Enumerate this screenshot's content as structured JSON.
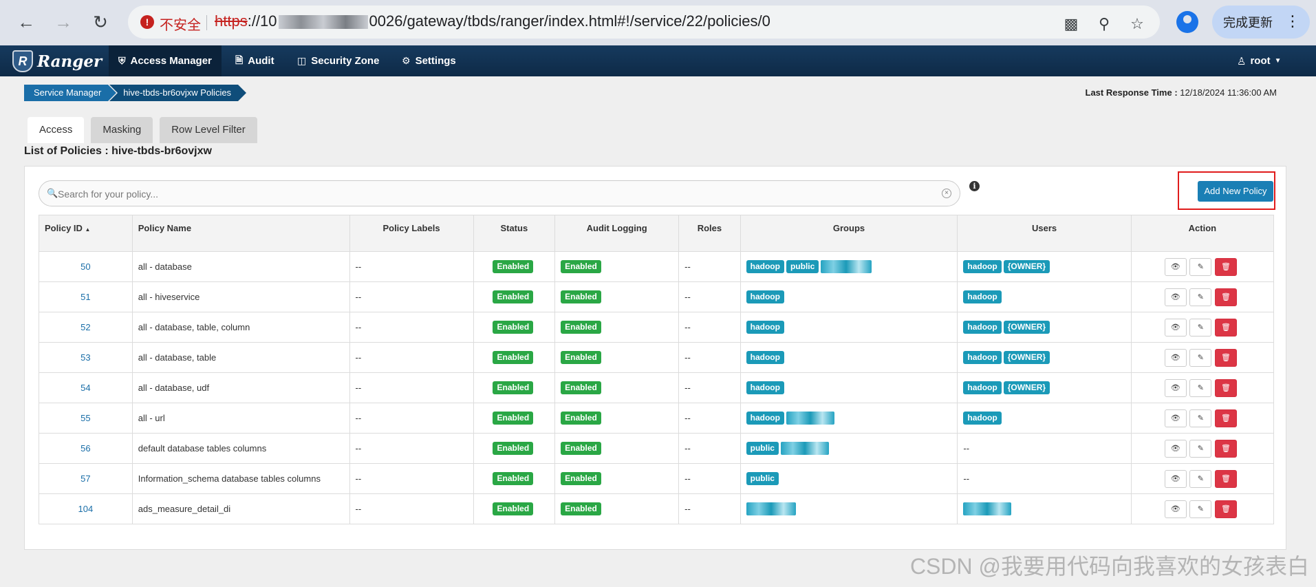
{
  "browser": {
    "security_label": "不安全",
    "url_scheme": "https",
    "url_host_prefix": "://10",
    "url_rest": "0026/gateway/tbds/ranger/index.html#!/service/22/policies/0",
    "update_label": "完成更新"
  },
  "nav": {
    "brand": "Ranger",
    "items": [
      {
        "label": "Access Manager"
      },
      {
        "label": "Audit"
      },
      {
        "label": "Security Zone"
      },
      {
        "label": "Settings"
      }
    ],
    "user": "root"
  },
  "breadcrumb": [
    "Service Manager",
    "hive-tbds-br6ovjxw Policies"
  ],
  "last_response": {
    "label": "Last Response Time :",
    "value": "12/18/2024 11:36:00 AM"
  },
  "tabs": [
    {
      "label": "Access",
      "active": true
    },
    {
      "label": "Masking",
      "active": false
    },
    {
      "label": "Row Level Filter",
      "active": false
    }
  ],
  "list_title": "List of Policies : hive-tbds-br6ovjxw",
  "search": {
    "placeholder": "Search for your policy..."
  },
  "add_button": "Add New Policy",
  "columns": [
    "Policy ID",
    "Policy Name",
    "Policy Labels",
    "Status",
    "Audit Logging",
    "Roles",
    "Groups",
    "Users",
    "Action"
  ],
  "rows": [
    {
      "id": "50",
      "name": "all - database",
      "labels": "--",
      "status": "Enabled",
      "audit": "Enabled",
      "roles": "--",
      "groups": [
        "hadoop",
        "public"
      ],
      "users": [
        "hadoop",
        "{OWNER}"
      ]
    },
    {
      "id": "51",
      "name": "all - hiveservice",
      "labels": "--",
      "status": "Enabled",
      "audit": "Enabled",
      "roles": "--",
      "groups": [
        "hadoop"
      ],
      "users": [
        "hadoop"
      ]
    },
    {
      "id": "52",
      "name": "all - database, table, column",
      "labels": "--",
      "status": "Enabled",
      "audit": "Enabled",
      "roles": "--",
      "groups": [
        "hadoop"
      ],
      "users": [
        "hadoop",
        "{OWNER}"
      ]
    },
    {
      "id": "53",
      "name": "all - database, table",
      "labels": "--",
      "status": "Enabled",
      "audit": "Enabled",
      "roles": "--",
      "groups": [
        "hadoop"
      ],
      "users": [
        "hadoop",
        "{OWNER}"
      ]
    },
    {
      "id": "54",
      "name": "all - database, udf",
      "labels": "--",
      "status": "Enabled",
      "audit": "Enabled",
      "roles": "--",
      "groups": [
        "hadoop"
      ],
      "users": [
        "hadoop",
        "{OWNER}"
      ]
    },
    {
      "id": "55",
      "name": "all - url",
      "labels": "--",
      "status": "Enabled",
      "audit": "Enabled",
      "roles": "--",
      "groups": [
        "hadoop"
      ],
      "users": [
        "hadoop"
      ]
    },
    {
      "id": "56",
      "name": "default database tables columns",
      "labels": "--",
      "status": "Enabled",
      "audit": "Enabled",
      "roles": "--",
      "groups": [
        "public"
      ],
      "users_text": "--"
    },
    {
      "id": "57",
      "name": "Information_schema database tables columns",
      "labels": "--",
      "status": "Enabled",
      "audit": "Enabled",
      "roles": "--",
      "groups": [
        "public"
      ],
      "users_text": "--"
    },
    {
      "id": "104",
      "name": "ads_measure_detail_di",
      "labels": "--",
      "status": "Enabled",
      "audit": "Enabled",
      "roles": "--",
      "groups": [],
      "users": []
    }
  ],
  "watermark": "CSDN @我要用代码向我喜欢的女孩表白"
}
